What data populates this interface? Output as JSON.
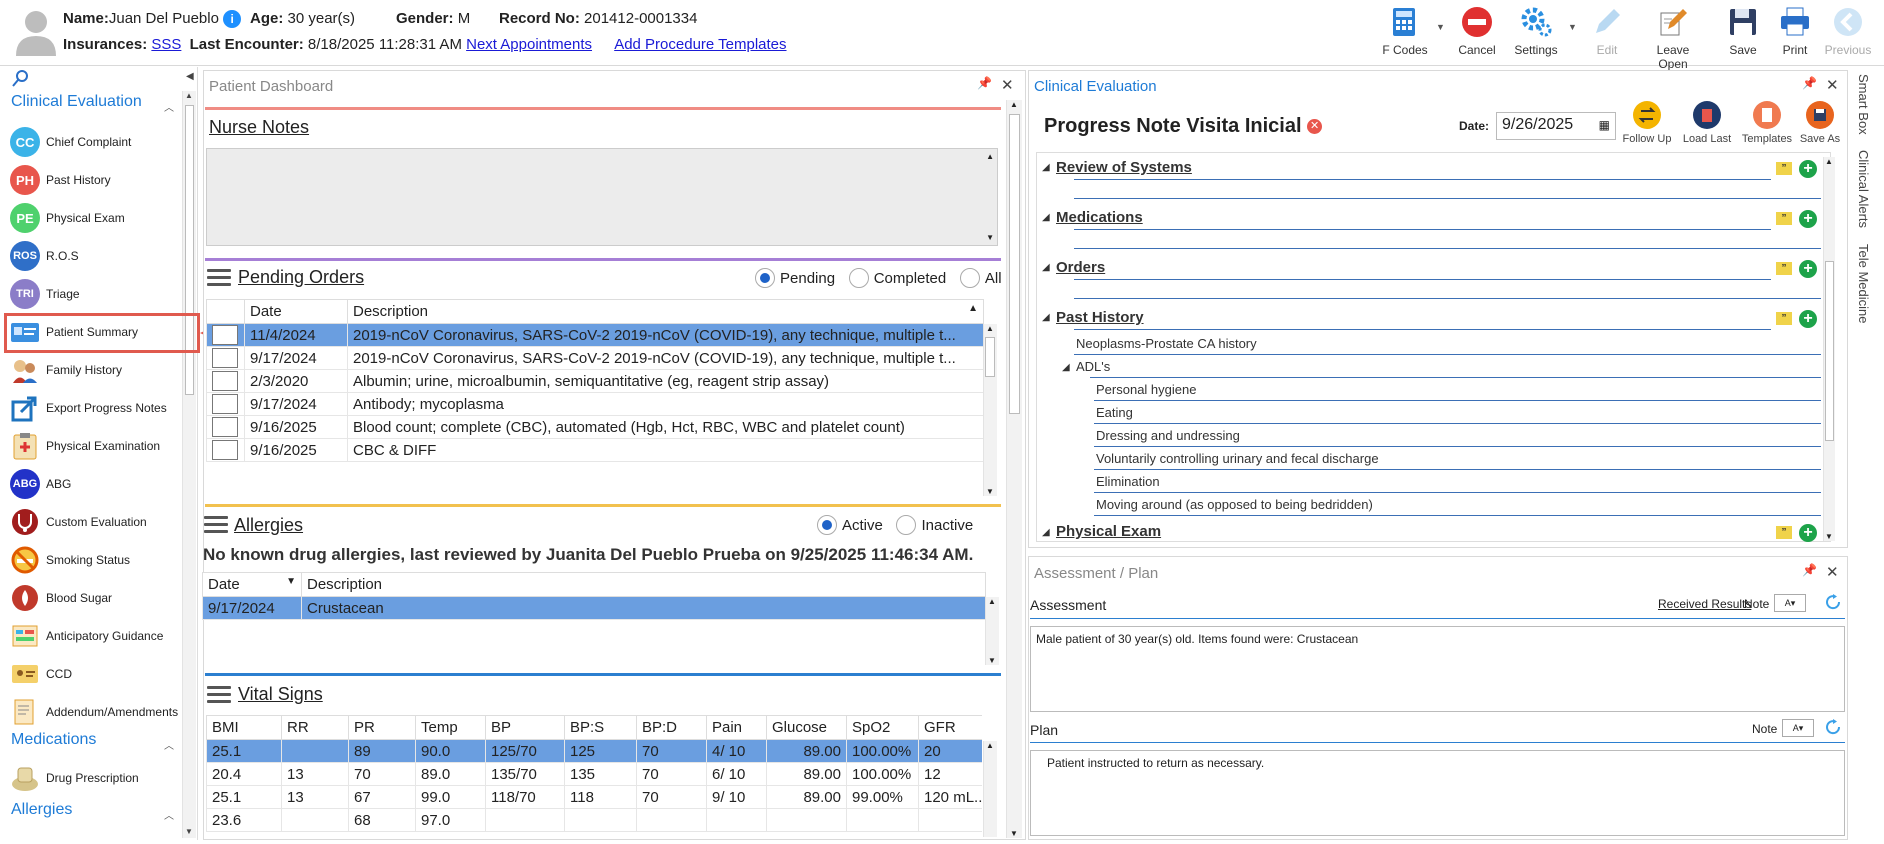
{
  "header": {
    "name_label": "Name:",
    "name_value": "Juan Del Pueblo",
    "age_label": "Age:",
    "age_value": "30 year(s)",
    "gender_label": "Gender:",
    "gender_value": "M",
    "record_label": "Record No:",
    "record_value": "201412-0001334",
    "insurances_label": "Insurances:",
    "insurances_value": "SSS",
    "last_encounter_label": "Last Encounter:",
    "last_encounter_value": "8/18/2025 11:28:31 AM",
    "next_appointments": "Next Appointments",
    "add_procedure_templates": "Add Procedure Templates"
  },
  "toolbar": {
    "fcodes": "F Codes",
    "cancel": "Cancel",
    "settings": "Settings",
    "edit": "Edit",
    "leave_open": "Leave Open",
    "save": "Save",
    "print": "Print",
    "previous": "Previous"
  },
  "nav": {
    "sections": {
      "clinical": "Clinical Evaluation",
      "medications": "Medications",
      "allergies": "Allergies"
    },
    "items": [
      {
        "label": "Chief Complaint",
        "abbr": "CC",
        "color": "#3bb3e8"
      },
      {
        "label": "Past History",
        "abbr": "PH",
        "color": "#e8564c"
      },
      {
        "label": "Physical Exam",
        "abbr": "PE",
        "color": "#4fd16d"
      },
      {
        "label": "R.O.S",
        "abbr": "ROS",
        "color": "#2f6fc8"
      },
      {
        "label": "Triage",
        "abbr": "TRI",
        "color": "#8b7dc8"
      },
      {
        "label": "Patient Summary",
        "abbr": "",
        "color": "#3a8fe0"
      },
      {
        "label": "Family History",
        "abbr": "",
        "color": "#c0392b"
      },
      {
        "label": "Export Progress Notes",
        "abbr": "",
        "color": "#1e73be"
      },
      {
        "label": "Physical Examination",
        "abbr": "",
        "color": "#e0a030"
      },
      {
        "label": "ABG",
        "abbr": "ABG",
        "color": "#2232c8"
      },
      {
        "label": "Custom Evaluation",
        "abbr": "",
        "color": "#a11d1d"
      },
      {
        "label": "Smoking Status",
        "abbr": "",
        "color": "#e0a020"
      },
      {
        "label": "Blood Sugar",
        "abbr": "",
        "color": "#c0392b"
      },
      {
        "label": "Anticipatory Guidance",
        "abbr": "",
        "color": "#e0a030"
      },
      {
        "label": "CCD",
        "abbr": "",
        "color": "#e8b040"
      },
      {
        "label": "Addendum/Amendments",
        "abbr": "",
        "color": "#e0a030"
      }
    ],
    "med_items": [
      {
        "label": "Drug Prescription"
      }
    ]
  },
  "dashboard": {
    "title": "Patient Dashboard",
    "nurse_notes": "Nurse Notes",
    "pending_orders": "Pending Orders",
    "radio_pending": "Pending",
    "radio_completed": "Completed",
    "radio_all": "All",
    "orders_cols": {
      "date": "Date",
      "description": "Description"
    },
    "orders": [
      {
        "date": "11/4/2024",
        "desc": "2019-nCoV Coronavirus, SARS-CoV-2 2019-nCoV (COVID-19), any technique, multiple t..."
      },
      {
        "date": "9/17/2024",
        "desc": "2019-nCoV Coronavirus, SARS-CoV-2 2019-nCoV (COVID-19), any technique, multiple t..."
      },
      {
        "date": "2/3/2020",
        "desc": "Albumin; urine, microalbumin, semiquantitative (eg, reagent strip assay)"
      },
      {
        "date": "9/17/2024",
        "desc": "Antibody; mycoplasma"
      },
      {
        "date": "9/16/2025",
        "desc": "Blood count; complete (CBC), automated (Hgb, Hct, RBC, WBC and platelet count)"
      },
      {
        "date": "9/16/2025",
        "desc": "CBC & DIFF"
      }
    ],
    "allergies": "Allergies",
    "radio_active": "Active",
    "radio_inactive": "Inactive",
    "allergy_note": "No known drug allergies, last reviewed by Juanita Del Pueblo Prueba on 9/25/2025 11:46:34 AM.",
    "allergy_cols": {
      "date": "Date",
      "description": "Description"
    },
    "allergy_rows": [
      {
        "date": "9/17/2024",
        "desc": "Crustacean"
      }
    ],
    "vital_signs": "Vital Signs",
    "vital_cols": [
      "BMI",
      "RR",
      "PR",
      "Temp",
      "BP",
      "BP:S",
      "BP:D",
      "Pain",
      "Glucose",
      "SpO2",
      "GFR"
    ],
    "vital_rows": [
      [
        "25.1",
        "",
        "89",
        "90.0",
        "125/70",
        "125",
        "70",
        "4/ 10",
        "89.00",
        "100.00%",
        "20"
      ],
      [
        "20.4",
        "13",
        "70",
        "89.0",
        "135/70",
        "135",
        "70",
        "6/ 10",
        "89.00",
        "100.00%",
        "12"
      ],
      [
        "25.1",
        "13",
        "67",
        "99.0",
        "118/70",
        "118",
        "70",
        "9/ 10",
        "89.00",
        "99.00%",
        "120 mL..."
      ],
      [
        "23.6",
        "",
        "68",
        "97.0",
        "",
        "",
        "",
        "",
        "",
        "",
        ""
      ]
    ]
  },
  "clinical": {
    "title": "Clinical Evaluation",
    "note_title": "Progress Note Visita Inicial",
    "date_label": "Date:",
    "date_value": "9/26/2025",
    "actions": {
      "follow_up": "Follow Up",
      "load_last": "Load Last",
      "templates": "Templates",
      "save_as": "Save As"
    },
    "sections": {
      "ros": "Review of Systems",
      "medications": "Medications",
      "orders": "Orders",
      "past_history": "Past History",
      "physical_exam": "Physical Exam"
    },
    "past_history_items": {
      "neoplasms": "Neoplasms-Prostate CA history",
      "adls": "ADL's"
    },
    "adl_items": [
      "Personal hygiene",
      "Eating",
      "Dressing and undressing",
      "Voluntarily controlling urinary and fecal discharge",
      "Elimination",
      "Moving around (as opposed to being bedridden)"
    ]
  },
  "side_tabs": {
    "smart_box": "Smart Box",
    "clinical_alerts": "Clinical Alerts",
    "tele_medicine": "Tele Medicine"
  },
  "assessment": {
    "title": "Assessment / Plan",
    "assessment_label": "Assessment",
    "received_results": "Received Results",
    "note_label": "Note",
    "assessment_text": "Male patient of 30 year(s) old. Items found were:  Crustacean",
    "plan_label": "Plan",
    "plan_note_label": "Note",
    "plan_text": "Patient instructed to return as necessary."
  }
}
